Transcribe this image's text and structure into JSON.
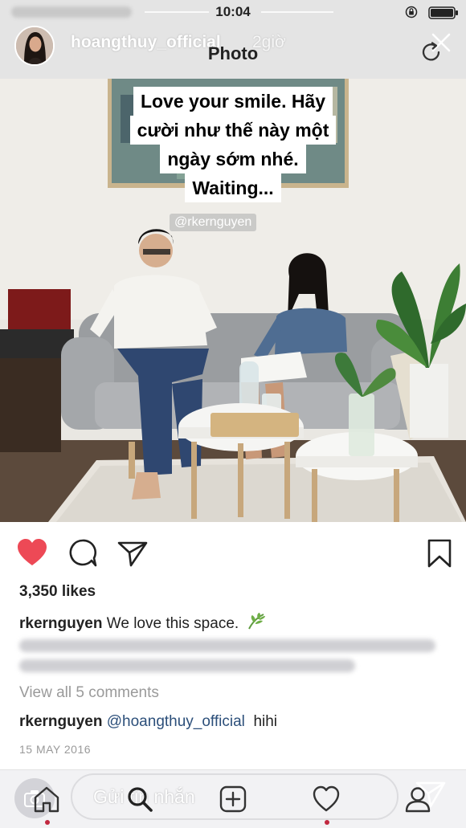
{
  "status_bar": {
    "time": "10:04"
  },
  "story": {
    "username": "hoangthuy_official",
    "time_ago": "2giờ",
    "reply_placeholder": "Gửi tin nhắn"
  },
  "header": {
    "title": "Photo"
  },
  "photo": {
    "caption_lines": [
      "Love your smile. Hãy",
      "cười như thế này một",
      "ngày sớm nhé.",
      "Waiting..."
    ],
    "mention": "@rkernguyen"
  },
  "post": {
    "likes": "3,350 likes",
    "author": "rkernguyen",
    "caption": "We love this space.",
    "view_comments": "View all 5 comments",
    "comment": {
      "user": "rkernguyen",
      "mention": "@hoangthuy_official",
      "text": "hihi"
    },
    "date": "15 MAY 2016"
  },
  "icons": {
    "heart": "heart-icon",
    "comment": "comment-icon",
    "share": "share-icon",
    "bookmark": "bookmark-icon",
    "home": "home-icon",
    "search": "search-icon",
    "add": "add-icon",
    "activity": "heart-outline-icon",
    "profile": "profile-icon",
    "send": "send-icon",
    "camera": "camera-icon",
    "close": "close-icon",
    "refresh": "refresh-icon"
  },
  "colors": {
    "like_red": "#ed4956",
    "mention_blue": "#2c4f7a",
    "muted_gray": "#9a9a9a",
    "notification_dot": "#c1283f"
  }
}
